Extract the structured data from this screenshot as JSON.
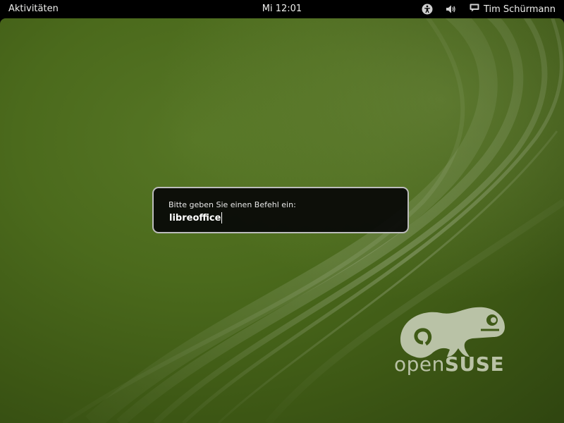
{
  "top_panel": {
    "activities_label": "Aktivitäten",
    "clock": "Mi 12:01",
    "tray_icons": [
      "accessibility-icon",
      "volume-icon",
      "chat-status-icon"
    ],
    "user_name": "Tim Schürmann"
  },
  "run_dialog": {
    "prompt": "Bitte geben Sie einen Befehl ein:",
    "input_value": "libreoffice"
  },
  "wallpaper": {
    "brand_light": "open",
    "brand_bold": "SUSE",
    "colors": {
      "background": "#4b6a1c",
      "logo": "#b9c2a6"
    }
  }
}
